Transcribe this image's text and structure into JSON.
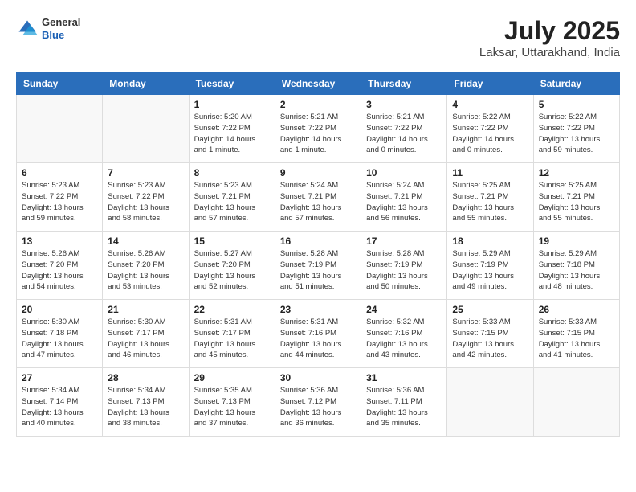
{
  "header": {
    "logo_general": "General",
    "logo_blue": "Blue",
    "month_year": "July 2025",
    "location": "Laksar, Uttarakhand, India"
  },
  "weekdays": [
    "Sunday",
    "Monday",
    "Tuesday",
    "Wednesday",
    "Thursday",
    "Friday",
    "Saturday"
  ],
  "weeks": [
    [
      {
        "day": "",
        "sunrise": "",
        "sunset": "",
        "daylight": ""
      },
      {
        "day": "",
        "sunrise": "",
        "sunset": "",
        "daylight": ""
      },
      {
        "day": "1",
        "sunrise": "Sunrise: 5:20 AM",
        "sunset": "Sunset: 7:22 PM",
        "daylight": "Daylight: 14 hours and 1 minute."
      },
      {
        "day": "2",
        "sunrise": "Sunrise: 5:21 AM",
        "sunset": "Sunset: 7:22 PM",
        "daylight": "Daylight: 14 hours and 1 minute."
      },
      {
        "day": "3",
        "sunrise": "Sunrise: 5:21 AM",
        "sunset": "Sunset: 7:22 PM",
        "daylight": "Daylight: 14 hours and 0 minutes."
      },
      {
        "day": "4",
        "sunrise": "Sunrise: 5:22 AM",
        "sunset": "Sunset: 7:22 PM",
        "daylight": "Daylight: 14 hours and 0 minutes."
      },
      {
        "day": "5",
        "sunrise": "Sunrise: 5:22 AM",
        "sunset": "Sunset: 7:22 PM",
        "daylight": "Daylight: 13 hours and 59 minutes."
      }
    ],
    [
      {
        "day": "6",
        "sunrise": "Sunrise: 5:23 AM",
        "sunset": "Sunset: 7:22 PM",
        "daylight": "Daylight: 13 hours and 59 minutes."
      },
      {
        "day": "7",
        "sunrise": "Sunrise: 5:23 AM",
        "sunset": "Sunset: 7:22 PM",
        "daylight": "Daylight: 13 hours and 58 minutes."
      },
      {
        "day": "8",
        "sunrise": "Sunrise: 5:23 AM",
        "sunset": "Sunset: 7:21 PM",
        "daylight": "Daylight: 13 hours and 57 minutes."
      },
      {
        "day": "9",
        "sunrise": "Sunrise: 5:24 AM",
        "sunset": "Sunset: 7:21 PM",
        "daylight": "Daylight: 13 hours and 57 minutes."
      },
      {
        "day": "10",
        "sunrise": "Sunrise: 5:24 AM",
        "sunset": "Sunset: 7:21 PM",
        "daylight": "Daylight: 13 hours and 56 minutes."
      },
      {
        "day": "11",
        "sunrise": "Sunrise: 5:25 AM",
        "sunset": "Sunset: 7:21 PM",
        "daylight": "Daylight: 13 hours and 55 minutes."
      },
      {
        "day": "12",
        "sunrise": "Sunrise: 5:25 AM",
        "sunset": "Sunset: 7:21 PM",
        "daylight": "Daylight: 13 hours and 55 minutes."
      }
    ],
    [
      {
        "day": "13",
        "sunrise": "Sunrise: 5:26 AM",
        "sunset": "Sunset: 7:20 PM",
        "daylight": "Daylight: 13 hours and 54 minutes."
      },
      {
        "day": "14",
        "sunrise": "Sunrise: 5:26 AM",
        "sunset": "Sunset: 7:20 PM",
        "daylight": "Daylight: 13 hours and 53 minutes."
      },
      {
        "day": "15",
        "sunrise": "Sunrise: 5:27 AM",
        "sunset": "Sunset: 7:20 PM",
        "daylight": "Daylight: 13 hours and 52 minutes."
      },
      {
        "day": "16",
        "sunrise": "Sunrise: 5:28 AM",
        "sunset": "Sunset: 7:19 PM",
        "daylight": "Daylight: 13 hours and 51 minutes."
      },
      {
        "day": "17",
        "sunrise": "Sunrise: 5:28 AM",
        "sunset": "Sunset: 7:19 PM",
        "daylight": "Daylight: 13 hours and 50 minutes."
      },
      {
        "day": "18",
        "sunrise": "Sunrise: 5:29 AM",
        "sunset": "Sunset: 7:19 PM",
        "daylight": "Daylight: 13 hours and 49 minutes."
      },
      {
        "day": "19",
        "sunrise": "Sunrise: 5:29 AM",
        "sunset": "Sunset: 7:18 PM",
        "daylight": "Daylight: 13 hours and 48 minutes."
      }
    ],
    [
      {
        "day": "20",
        "sunrise": "Sunrise: 5:30 AM",
        "sunset": "Sunset: 7:18 PM",
        "daylight": "Daylight: 13 hours and 47 minutes."
      },
      {
        "day": "21",
        "sunrise": "Sunrise: 5:30 AM",
        "sunset": "Sunset: 7:17 PM",
        "daylight": "Daylight: 13 hours and 46 minutes."
      },
      {
        "day": "22",
        "sunrise": "Sunrise: 5:31 AM",
        "sunset": "Sunset: 7:17 PM",
        "daylight": "Daylight: 13 hours and 45 minutes."
      },
      {
        "day": "23",
        "sunrise": "Sunrise: 5:31 AM",
        "sunset": "Sunset: 7:16 PM",
        "daylight": "Daylight: 13 hours and 44 minutes."
      },
      {
        "day": "24",
        "sunrise": "Sunrise: 5:32 AM",
        "sunset": "Sunset: 7:16 PM",
        "daylight": "Daylight: 13 hours and 43 minutes."
      },
      {
        "day": "25",
        "sunrise": "Sunrise: 5:33 AM",
        "sunset": "Sunset: 7:15 PM",
        "daylight": "Daylight: 13 hours and 42 minutes."
      },
      {
        "day": "26",
        "sunrise": "Sunrise: 5:33 AM",
        "sunset": "Sunset: 7:15 PM",
        "daylight": "Daylight: 13 hours and 41 minutes."
      }
    ],
    [
      {
        "day": "27",
        "sunrise": "Sunrise: 5:34 AM",
        "sunset": "Sunset: 7:14 PM",
        "daylight": "Daylight: 13 hours and 40 minutes."
      },
      {
        "day": "28",
        "sunrise": "Sunrise: 5:34 AM",
        "sunset": "Sunset: 7:13 PM",
        "daylight": "Daylight: 13 hours and 38 minutes."
      },
      {
        "day": "29",
        "sunrise": "Sunrise: 5:35 AM",
        "sunset": "Sunset: 7:13 PM",
        "daylight": "Daylight: 13 hours and 37 minutes."
      },
      {
        "day": "30",
        "sunrise": "Sunrise: 5:36 AM",
        "sunset": "Sunset: 7:12 PM",
        "daylight": "Daylight: 13 hours and 36 minutes."
      },
      {
        "day": "31",
        "sunrise": "Sunrise: 5:36 AM",
        "sunset": "Sunset: 7:11 PM",
        "daylight": "Daylight: 13 hours and 35 minutes."
      },
      {
        "day": "",
        "sunrise": "",
        "sunset": "",
        "daylight": ""
      },
      {
        "day": "",
        "sunrise": "",
        "sunset": "",
        "daylight": ""
      }
    ]
  ]
}
